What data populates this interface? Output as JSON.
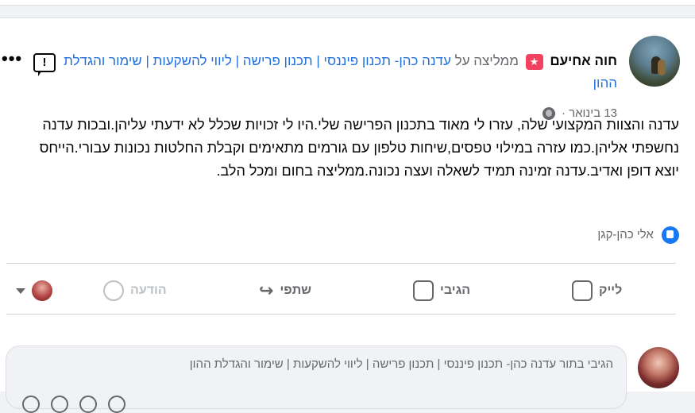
{
  "post": {
    "author": "חוה אחיעם",
    "recommends_text": "ממליצה על",
    "page_name": "עדנה כהן- תכנון פיננסי | תכנון פרישה | ליווי להשקעות | שימור והגדלת ההון",
    "page_name_cont": "להשקעות | שימור והגדלת ההון.",
    "date": "13 בינואר ·",
    "body": "עדנה והצוות המקצועי שלה, עזרו לי מאוד בתכנון הפרישה שלי.היו לי זכויות שכלל לא ידעתי עליהן.ובכות עדנה נחשפתי אליהן.כמו עזרה במילוי טפסים,שיחות טלפון עם גורמים מתאימים וקבלת החלטות נכונות עבורי.הייחס יוצא דופן ואדיב.עדנה זמינה תמיד לשאלה ועצה נכונה.ממליצה בחום ומכל הלב.",
    "liked_by": "אלי כהן-קגן"
  },
  "header_line1": "ממליצה על עדנה כהן- תכנון פיננסי | תכנון פרישה | ליווי",
  "actions": {
    "like": "לייק",
    "comment": "הגיבי",
    "share": "שתפי",
    "message": "הודעה"
  },
  "comment": {
    "placeholder": "הגיבי בתור עדנה כהן- תכנון פיננסי | תכנון פרישה | ליווי להשקעות | שימור והגדלת ההון"
  },
  "icons": {
    "recommend": "recommend-star-icon",
    "report": "report-icon",
    "more": "more-options-icon",
    "globe": "globe-icon",
    "like": "like-thumb-icon",
    "comment": "comment-bubble-icon",
    "share": "share-arrow-icon",
    "message": "messenger-icon"
  },
  "colors": {
    "recommend_badge": "#f3425f",
    "like_blue": "#1877f2",
    "muted_text": "#65676b"
  }
}
